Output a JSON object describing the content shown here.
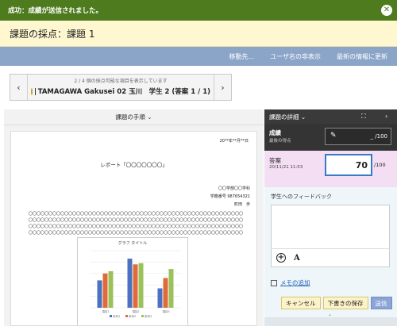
{
  "success": {
    "message": "成功：成績が送信されました。",
    "close_glyph": "✕"
  },
  "page_title": "課題の採点：課題 1",
  "menu": [
    "移動先...",
    "ユーザ名の非表示",
    "最新の情報に更新"
  ],
  "navigator": {
    "count_text": "2 / 4 個の採点可能な項目を表示しています",
    "student": "TAMAGAWA Gakusei 02 玉川　学生 2 (答案 1 / 1)",
    "prev_glyph": "‹",
    "next_glyph": "›"
  },
  "instructions": {
    "label": "課題の手順",
    "chevron": "⌄"
  },
  "document": {
    "date": "20**年**月**日",
    "title": "レポート「〇〇〇〇〇〇〇」",
    "info": [
      "〇〇学部〇〇学科",
      "学籍番号 987654321",
      "町田　歩"
    ],
    "circles": "〇〇〇〇〇〇〇〇〇〇〇〇〇〇〇〇〇〇〇〇〇〇〇〇〇〇〇〇〇〇〇〇〇〇〇〇〇〇〇〇〇〇〇〇〇〇〇〇〇〇〇〇〇〇",
    "chart_title": "グラフ タイトル"
  },
  "chart_data": {
    "type": "bar",
    "title": "グラフ タイトル",
    "categories": [
      "項目1",
      "項目2",
      "項目3"
    ],
    "series": [
      {
        "name": "系列1",
        "color": "#4a72c0",
        "values": [
          2.4,
          4.3,
          1.7
        ]
      },
      {
        "name": "系列2",
        "color": "#e06a3a",
        "values": [
          3.0,
          3.8,
          2.6
        ]
      },
      {
        "name": "系列3",
        "color": "#9cc05a",
        "values": [
          3.2,
          3.9,
          3.4
        ]
      }
    ],
    "ylim": [
      0,
      5
    ],
    "grid": true,
    "legend": "bottom"
  },
  "details": {
    "header": "課題の詳細",
    "expand_glyph": "⌄",
    "fullscreen_glyph": "⛶",
    "next_glyph": "›",
    "grade_label": "成績",
    "grade_sub": "最後の得点",
    "grade_value": "_ /100",
    "pencil_glyph": "✎",
    "answer_label": "答案",
    "answer_date": "20/11/21 11:53",
    "answer_score": "70",
    "answer_max": "/100",
    "feedback_label": "学生へのフィードバック",
    "plus_glyph": "+",
    "font_glyph": "A",
    "memo_label": "メモの追加",
    "cancel": "キャンセル",
    "save_draft": "下書きの保存",
    "send": "送信",
    "collapse_glyph": "⌃"
  }
}
